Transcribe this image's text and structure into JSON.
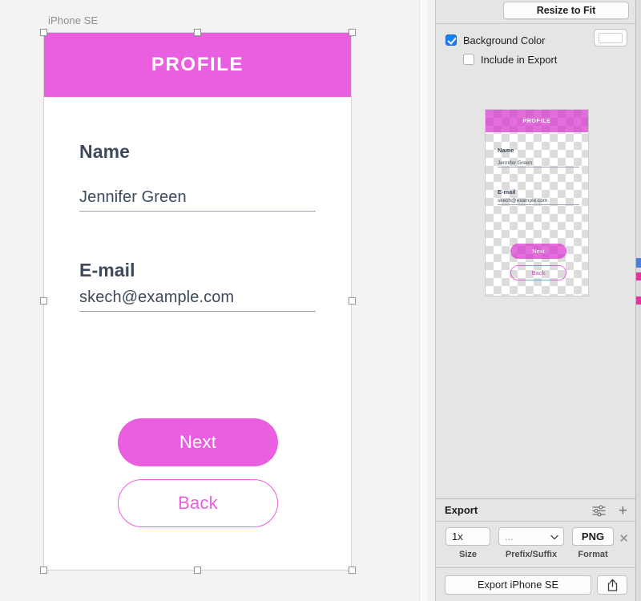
{
  "canvas": {
    "artboard_label": "iPhone SE",
    "artboard": {
      "header_title": "PROFILE",
      "header_color": "#ea5fe0",
      "text_color": "#3c4a5b",
      "fields": [
        {
          "label": "Name",
          "value": "Jennifer Green"
        },
        {
          "label": "E-mail",
          "value": "skech@example.com"
        }
      ],
      "buttons": [
        {
          "label": "Next",
          "style": "filled"
        },
        {
          "label": "Back",
          "style": "outline"
        }
      ]
    }
  },
  "inspector": {
    "resize_to_fit_label": "Resize to Fit",
    "background": {
      "background_color_label": "Background Color",
      "background_color_checked": true,
      "include_in_export_label": "Include in Export",
      "include_in_export_checked": false,
      "swatch_color": "#ffffff"
    },
    "preview": {
      "header_title": "PROFILE",
      "fields": [
        {
          "label": "Name",
          "value": "Jennifer Green"
        },
        {
          "label": "E-mail",
          "value": "skech@example.com"
        }
      ],
      "buttons": [
        {
          "label": "Next"
        },
        {
          "label": "Back"
        }
      ]
    },
    "export": {
      "title": "Export",
      "options_icon": "sliders-icon",
      "add_icon": "plus-icon",
      "size_value": "1x",
      "size_caption": "Size",
      "prefix_value": "...",
      "prefix_caption": "Prefix/Suffix",
      "format_value": "PNG",
      "format_caption": "Format",
      "remove_icon": "close-icon",
      "export_button_label": "Export iPhone SE",
      "share_icon": "share-icon"
    }
  }
}
